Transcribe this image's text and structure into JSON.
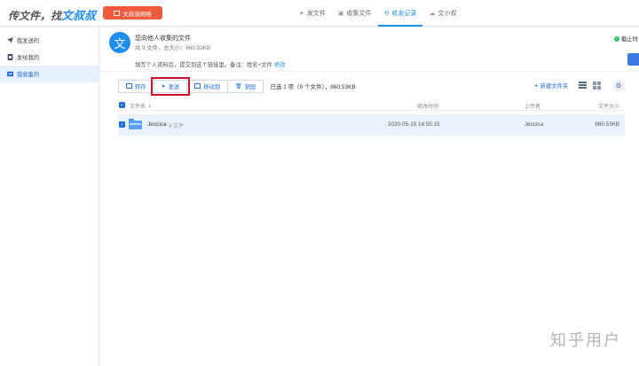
{
  "header": {
    "logo_prefix": "传文件，找",
    "logo_brand": "文叔叔",
    "wenshu_button": "文叔叔网格",
    "nav": [
      {
        "label": "发文件",
        "icon": "send-icon",
        "active": false
      },
      {
        "label": "收集文件",
        "icon": "inbox-icon",
        "active": false
      },
      {
        "label": "收发记录",
        "icon": "record-icon",
        "active": true
      },
      {
        "label": "文小叔",
        "icon": "cloud-icon",
        "active": false
      }
    ]
  },
  "sidebar": {
    "items": [
      {
        "label": "我发送的",
        "icon": "send-icon",
        "active": false
      },
      {
        "label": "发给我的",
        "icon": "inbox-icon",
        "active": false
      },
      {
        "label": "我收集的",
        "icon": "collect-icon",
        "active": true
      }
    ]
  },
  "info": {
    "avatar_char": "文",
    "title": "您向他人收集的文件",
    "meta": "共 9 文件，总大小：860.53KB",
    "note": "填写个人资料后，提交到这个链接里。备注：姓名+文件",
    "edit_link": "修改",
    "status_text": "截止时"
  },
  "toolbar": {
    "buttons": [
      {
        "label": "转存",
        "icon": "save-icon"
      },
      {
        "label": "发送",
        "icon": "send-icon",
        "highlighted": true
      },
      {
        "label": "移动到",
        "icon": "move-icon"
      },
      {
        "label": "销毁",
        "icon": "trash-icon"
      }
    ],
    "selected_info": "已选 1 项（9 个文件），860.53KB",
    "new_folder": "新建文件夹"
  },
  "table": {
    "headers": {
      "name": "文件名",
      "modified": "修改时间",
      "uploader": "上传者",
      "size": "文件大小"
    },
    "rows": [
      {
        "name": "Jeccica",
        "count": "9 文件",
        "modified": "2020-05-15 14:55:15",
        "uploader": "Jeccica",
        "size": "860.53KB",
        "checked": true
      }
    ]
  },
  "watermark": "知乎用户",
  "colors": {
    "accent": "#1f8ef1",
    "orange": "#f05b3b",
    "highlight_border": "#c8102e"
  }
}
